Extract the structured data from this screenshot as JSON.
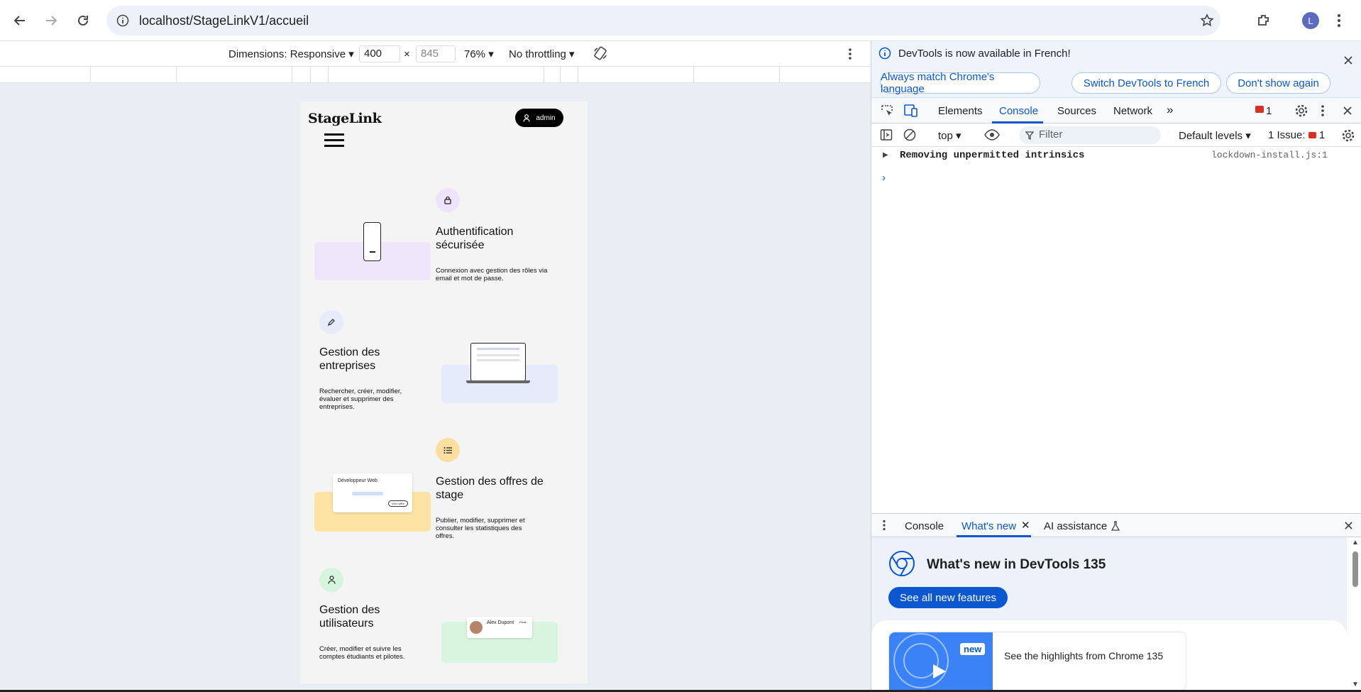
{
  "browser": {
    "url": "localhost/StageLinkV1/accueil",
    "profile_initial": "L"
  },
  "device_toolbar": {
    "dimensions_label": "Dimensions: Responsive",
    "width": "400",
    "height": "845",
    "times": "×",
    "zoom": "76%",
    "throttling": "No throttling"
  },
  "site": {
    "logo": "StageLink",
    "user_label": "admin",
    "features": [
      {
        "title": "Authentification sécurisée",
        "desc": "Connexion avec gestion des rôles via email et mot de passe.",
        "icon": "lock-icon"
      },
      {
        "title": "Gestion des entreprises",
        "desc": "Rechercher, créer, modifier, évaluer et supprimer des entreprises.",
        "icon": "pencil-icon"
      },
      {
        "title": "Gestion des offres de stage",
        "desc": "Publier, modifier, supprimer et consulter les statistiques des offres.",
        "icon": "list-icon"
      },
      {
        "title": "Gestion des utilisateurs",
        "desc": "Créer, modifier et suivre les comptes étudiants et pilotes.",
        "icon": "user-icon"
      }
    ],
    "offer_card": {
      "title": "Développeur Web",
      "button": "Voir l'offre"
    },
    "user_card": {
      "name": "Alex Dupont",
      "tag": "Pilote"
    }
  },
  "devtools": {
    "info_text": "DevTools is now available in French!",
    "info_buttons": [
      "Always match Chrome's language",
      "Switch DevTools to French",
      "Don't show again"
    ],
    "tabs": [
      "Elements",
      "Console",
      "Sources",
      "Network"
    ],
    "error_count": "1",
    "context": "top",
    "filter_placeholder": "Filter",
    "levels": "Default levels",
    "issues_label": "1 Issue:",
    "issues_count": "1",
    "message": "Removing unpermitted intrinsics",
    "message_source": "lockdown-install.js:1",
    "drawer_tabs": [
      "Console",
      "What's new",
      "AI assistance"
    ],
    "whats_new_title": "What's new in DevTools 135",
    "see_all": "See all new features",
    "badge_new": "new",
    "highlights": "See the highlights from Chrome 135"
  },
  "colors": {
    "accent": "#0b57d0",
    "lavender": "#efe6fb",
    "blue_card": "#e6ebfb",
    "yellow": "#fde3a4",
    "green": "#d8f5df"
  }
}
